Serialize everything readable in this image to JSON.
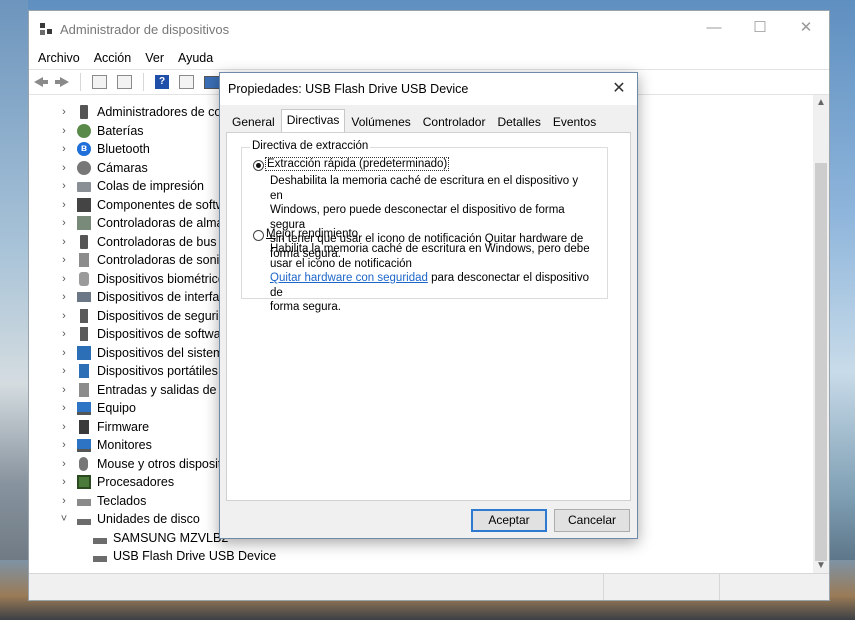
{
  "window": {
    "title": "Administrador de dispositivos",
    "controls": {
      "minimize": "—",
      "maximize": "☐",
      "close": "✕"
    }
  },
  "menu": [
    "Archivo",
    "Acción",
    "Ver",
    "Ayuda"
  ],
  "tree": {
    "items": [
      {
        "label": "Administradores de con",
        "icon": "usb-icon",
        "expanded": false
      },
      {
        "label": "Baterías",
        "icon": "battery-icon",
        "expanded": false
      },
      {
        "label": "Bluetooth",
        "icon": "bluetooth-icon",
        "expanded": false
      },
      {
        "label": "Cámaras",
        "icon": "camera-icon",
        "expanded": false
      },
      {
        "label": "Colas de impresión",
        "icon": "printer-icon",
        "expanded": false
      },
      {
        "label": "Componentes de softw",
        "icon": "software-component-icon",
        "expanded": false
      },
      {
        "label": "Controladoras de almac",
        "icon": "storage-controller-icon",
        "expanded": false
      },
      {
        "label": "Controladoras de bus s",
        "icon": "usb-icon",
        "expanded": false
      },
      {
        "label": "Controladoras de sonid",
        "icon": "speaker-icon",
        "expanded": false
      },
      {
        "label": "Dispositivos biométrico",
        "icon": "biometric-icon",
        "expanded": false
      },
      {
        "label": "Dispositivos de interfaz",
        "icon": "hid-icon",
        "expanded": false
      },
      {
        "label": "Dispositivos de segurid",
        "icon": "security-icon",
        "expanded": false
      },
      {
        "label": "Dispositivos de softwar",
        "icon": "software-device-icon",
        "expanded": false
      },
      {
        "label": "Dispositivos del sistema",
        "icon": "system-icon",
        "expanded": false
      },
      {
        "label": "Dispositivos portátiles",
        "icon": "portable-icon",
        "expanded": false
      },
      {
        "label": "Entradas y salidas de au",
        "icon": "audio-io-icon",
        "expanded": false
      },
      {
        "label": "Equipo",
        "icon": "computer-icon",
        "expanded": false
      },
      {
        "label": "Firmware",
        "icon": "firmware-icon",
        "expanded": false
      },
      {
        "label": "Monitores",
        "icon": "monitor-icon",
        "expanded": false
      },
      {
        "label": "Mouse y otros dispositi",
        "icon": "mouse-icon",
        "expanded": false
      },
      {
        "label": "Procesadores",
        "icon": "processor-icon",
        "expanded": false
      },
      {
        "label": "Teclados",
        "icon": "keyboard-icon",
        "expanded": false
      },
      {
        "label": "Unidades de disco",
        "icon": "disk-icon",
        "expanded": true
      }
    ],
    "children": [
      {
        "label": "SAMSUNG MZVLB2",
        "icon": "disk-icon"
      },
      {
        "label": "USB Flash Drive USB Device",
        "icon": "disk-icon"
      }
    ]
  },
  "dialog": {
    "title": "Propiedades: USB Flash Drive USB Device",
    "close": "✕",
    "tabs": [
      "General",
      "Directivas",
      "Volúmenes",
      "Controlador",
      "Detalles",
      "Eventos"
    ],
    "active_tab": "Directivas",
    "group_title": "Directiva de extracción",
    "option1": {
      "label": "Extracción rápida (predeterminado)",
      "selected": true,
      "desc": [
        "Deshabilita la memoria caché de escritura en el dispositivo y en",
        "Windows, pero puede desconectar el dispositivo de forma segura",
        "sin tener que usar el icono de notificación Quitar hardware de",
        "forma segura."
      ]
    },
    "option2": {
      "label": "Mejor rendimiento",
      "selected": false,
      "desc": [
        "Habilita la memoria caché de escritura en Windows, pero debe",
        "usar el icono de notificación"
      ],
      "link": "Quitar hardware con seguridad",
      "link_after": " para desconectar el dispositivo de",
      "desc_end": "forma segura."
    },
    "ok": "Aceptar",
    "cancel": "Cancelar"
  },
  "colors": {
    "accent": "#2e7ad1",
    "link": "#1d66c9"
  }
}
